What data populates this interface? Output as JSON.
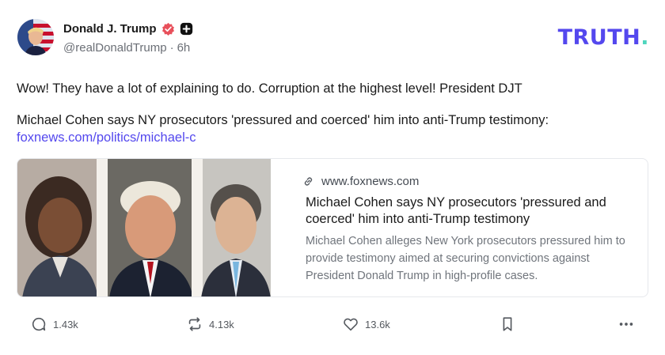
{
  "post": {
    "display_name": "Donald J. Trump",
    "handle": "@realDonaldTrump",
    "separator": "·",
    "time": "6h",
    "text": "Wow! They have a lot of explaining to do. Corruption at the highest level! President DJT",
    "shared_line": "Michael Cohen says NY prosecutors 'pressured and coerced' him into anti-Trump testimony:",
    "link_text": "foxnews.com/politics/michael-c"
  },
  "brand": {
    "logo_main": "TRUTH",
    "logo_dot": ".",
    "accent_color": "#5448ee",
    "dot_color": "#4fd6be",
    "verified_color": "#e8505b"
  },
  "card": {
    "domain": "www.foxnews.com",
    "title": "Michael Cohen says NY prosecutors 'pressured and coerced' him into anti-Trump testimony",
    "description": "Michael Cohen alleges New York prosecutors pressured him to provide testimony aimed at securing convictions against President Donald Trump in high-profile cases."
  },
  "actions": {
    "replies": "1.43k",
    "retruths": "4.13k",
    "likes": "13.6k"
  },
  "icons": [
    "verified-icon",
    "plus-icon",
    "link-icon",
    "reply-icon",
    "retruth-icon",
    "like-icon",
    "bookmark-icon",
    "more-icon"
  ]
}
